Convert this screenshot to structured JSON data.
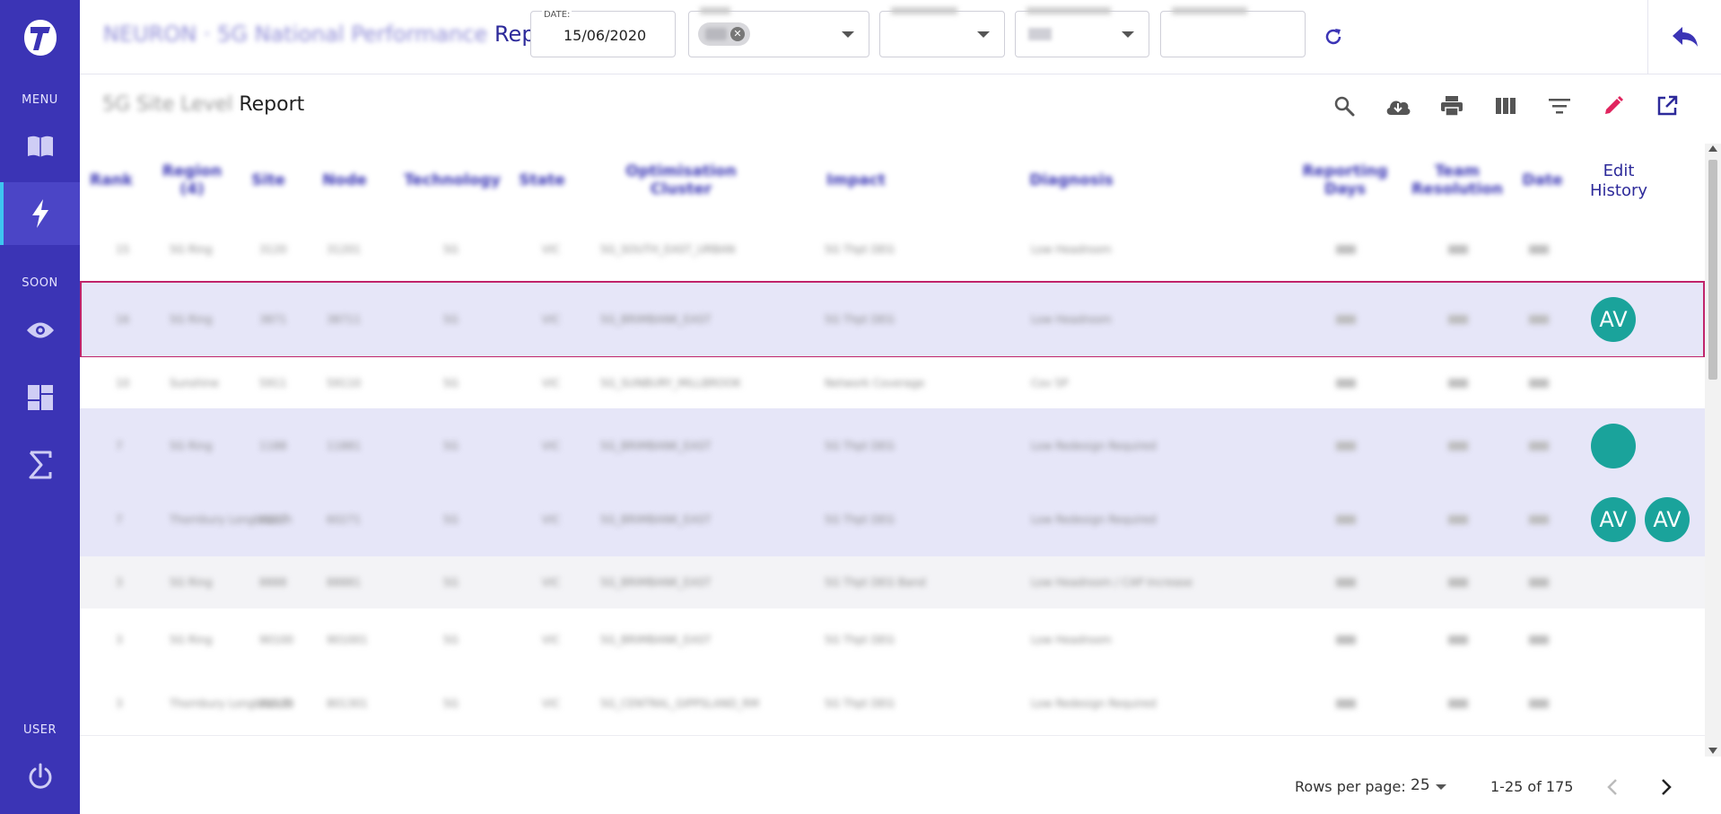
{
  "sidebar": {
    "menu_label": "MENU",
    "soon_label": "SOON",
    "user_label": "USER",
    "items": [
      {
        "name": "book-icon"
      },
      {
        "name": "bolt-icon",
        "active": true
      },
      {
        "name": "eye-icon"
      },
      {
        "name": "dashboard-icon"
      },
      {
        "name": "sigma-icon"
      },
      {
        "name": "power-icon"
      }
    ]
  },
  "header": {
    "title_blurred": "NEURON · 5G National Performance",
    "title_suffix": "Report",
    "date_label": "DATE:",
    "date_value": "15/06/2020"
  },
  "subheader": {
    "title_blurred": "5G Site Level",
    "title_suffix": "Report"
  },
  "table": {
    "edit_history_line1": "Edit",
    "edit_history_line2": "History",
    "rows": [
      {
        "rank": "15",
        "region": "5G Ring",
        "site": "3120",
        "node": "31201",
        "tech": "5G",
        "state": "VIC",
        "cluster": "5G_SOUTH_EAST_URBAN",
        "impact": "5G Thpt DEG",
        "diagnosis": "Low Headroom",
        "avatars": []
      },
      {
        "rank": "16",
        "region": "5G Ring",
        "site": "3871",
        "node": "38711",
        "tech": "5G",
        "state": "VIC",
        "cluster": "5G_BRIMBANK_EAST",
        "impact": "5G Thpt DEG",
        "diagnosis": "Low Headroom",
        "avatars": [
          "AV"
        ]
      },
      {
        "rank": "10",
        "region": "Sunshine",
        "site": "5911",
        "node": "59110",
        "tech": "5G",
        "state": "VIC",
        "cluster": "5G_SUNBURY_MILLBROOK",
        "impact": "Network Coverage",
        "diagnosis": "Cov 5P",
        "avatars": []
      },
      {
        "rank": "7",
        "region": "5G Ring",
        "site": "1188",
        "node": "11881",
        "tech": "5G",
        "state": "VIC",
        "cluster": "5G_BRIMBANK_EAST",
        "impact": "5G Thpt DEG",
        "diagnosis": "Low Redesign Required",
        "avatars": [
          ""
        ]
      },
      {
        "rank": "7",
        "region": "Thornbury Longbranch",
        "site": "6027",
        "node": "60271",
        "tech": "5G",
        "state": "VIC",
        "cluster": "5G_BRIMBANK_EAST",
        "impact": "5G Thpt DEG",
        "diagnosis": "Low Redesign Required",
        "avatars": [
          "AV",
          "AV"
        ]
      },
      {
        "rank": "3",
        "region": "5G Ring",
        "site": "8888",
        "node": "88881",
        "tech": "5G",
        "state": "VIC",
        "cluster": "5G_BRIMBANK_EAST",
        "impact": "5G Thpt DEG Band",
        "diagnosis": "Low Headroom / CAP Increase",
        "avatars": []
      },
      {
        "rank": "3",
        "region": "5G Ring",
        "site": "90100",
        "node": "901001",
        "tech": "5G",
        "state": "VIC",
        "cluster": "5G_BRIMBANK_EAST",
        "impact": "5G Thpt DEG",
        "diagnosis": "Low Headroom",
        "avatars": []
      },
      {
        "rank": "3",
        "region": "Thornbury Longbranch",
        "site": "80130",
        "node": "801301",
        "tech": "5G",
        "state": "VIC",
        "cluster": "5G_CENTRAL_GIPPSLAND_RM",
        "impact": "5G Thpt DEG",
        "diagnosis": "Low Redesign Required",
        "avatars": []
      }
    ]
  },
  "footer": {
    "rows_per_page_label": "Rows per page:",
    "rows_per_page_value": "25",
    "range_text": "1-25 of 175"
  }
}
